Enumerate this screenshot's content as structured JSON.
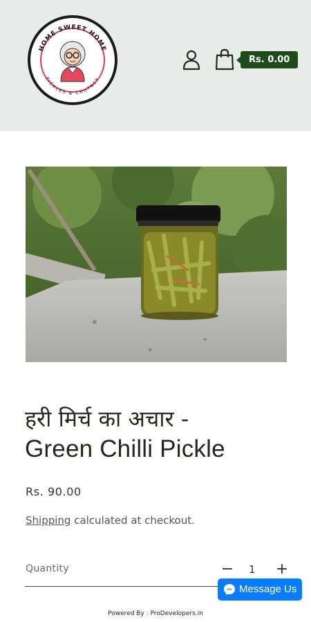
{
  "header": {
    "logo_alt": "Home Sweet Home Pickles & Chutney",
    "logo_top_text": "HOME SWEET HOME",
    "logo_bottom_text": "PICKLES & CHUTNEY",
    "account_icon": "person-icon",
    "cart_icon": "shopping-bag-icon",
    "cart_total": "Rs. 0.00"
  },
  "product": {
    "image_alt": "Jar of green chilli pickle on a concrete ledge",
    "title_line1": "हरी मिर्च का अचार -",
    "title_line2": "Green Chilli Pickle",
    "price": "Rs. 90.00",
    "shipping_link": "Shipping",
    "shipping_text": " calculated at checkout.",
    "quantity_label": "Quantity",
    "quantity_minus": "−",
    "quantity_value": "1",
    "quantity_plus": "+"
  },
  "messenger": {
    "label": "Message Us",
    "icon": "messenger-icon"
  },
  "footer": {
    "powered_by": "Powered By : ProDevelopers.in"
  },
  "colors": {
    "header_bg": "#e8ece9",
    "accent": "#1f4a1c",
    "messenger": "#0a7cff"
  }
}
